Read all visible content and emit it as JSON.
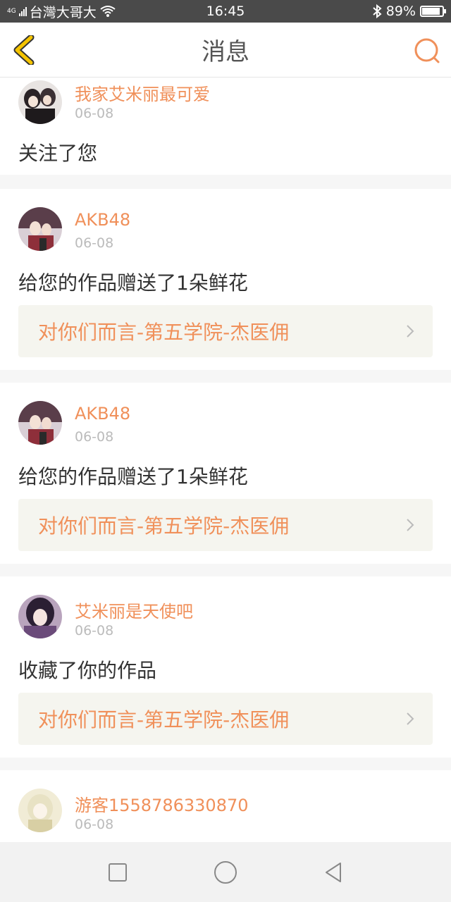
{
  "status_bar": {
    "network": "4G",
    "carrier": "台灣大哥大",
    "time": "16:45",
    "battery": "89%",
    "battery_level": 0.89,
    "icons": [
      "signal-icon",
      "wifi-icon",
      "bluetooth-icon",
      "battery-icon"
    ]
  },
  "header": {
    "title": "消息",
    "back_icon": "chevron-left-icon",
    "search_icon": "search-icon"
  },
  "messages": [
    {
      "user": "我家艾米丽最可爱",
      "date": "06-08",
      "action": "关注了您"
    },
    {
      "user": "AKB48",
      "date": "06-08",
      "action": "给您的作品赠送了1朵鲜花",
      "work": "对你们而言-第五学院-杰医佣"
    },
    {
      "user": "AKB48",
      "date": "06-08",
      "action": "给您的作品赠送了1朵鲜花",
      "work": "对你们而言-第五学院-杰医佣"
    },
    {
      "user": "艾米丽是天使吧",
      "date": "06-08",
      "action": "收藏了你的作品",
      "work": "对你们而言-第五学院-杰医佣"
    },
    {
      "user": "游客1558786330870",
      "date": "06-08"
    }
  ],
  "colors": {
    "accent": "#f0905a",
    "back_arrow": "#f5c400",
    "status_bar": "#4a4a4a",
    "work_bg": "#f5f5ef"
  },
  "system_nav": [
    "recents-square-icon",
    "home-circle-icon",
    "back-triangle-icon"
  ]
}
